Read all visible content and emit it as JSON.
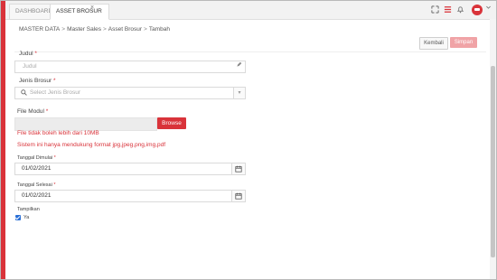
{
  "tabs": [
    {
      "label": "DASHBOARD"
    },
    {
      "label": "ASSET BROSUR",
      "close": "×"
    }
  ],
  "toolbar_icons": [
    "expand-icon",
    "list-icon",
    "bell-icon",
    "avatar",
    "chevron-down-icon"
  ],
  "breadcrumb": {
    "items": [
      "MASTER DATA",
      "Master Sales",
      "Asset Brosur",
      "Tambah"
    ],
    "separator": ">"
  },
  "actions": {
    "kembali": "Kembali",
    "simpan": "Simpan"
  },
  "form": {
    "judul": {
      "label": "Judul",
      "required": "*",
      "placeholder": "Judul"
    },
    "jenis": {
      "label": "Jenis Brosur",
      "required": "*",
      "placeholder": "Select Jenis Brosur"
    },
    "file": {
      "label": "File Modul",
      "required": "*",
      "browse": "Browse",
      "error_size": "File tidak boleh lebih dari 10MB",
      "error_format": "Sistem ini hanya mendukung format jpg,jpeg,png,img,pdf"
    },
    "tanggal_dimulai": {
      "label": "Tanggal Dimulai",
      "required": "*",
      "value": "01/02/2021"
    },
    "tanggal_selesai": {
      "label": "Tanggal Selesai",
      "required": "*",
      "value": "01/02/2021"
    },
    "tampilkan": {
      "label": "Tampilkan",
      "checkbox_label": "Ya",
      "checked": true
    }
  },
  "colors": {
    "accent": "#d9333a",
    "accent_disabled": "#f0a3a6",
    "checkbox": "#2a6fd6"
  }
}
